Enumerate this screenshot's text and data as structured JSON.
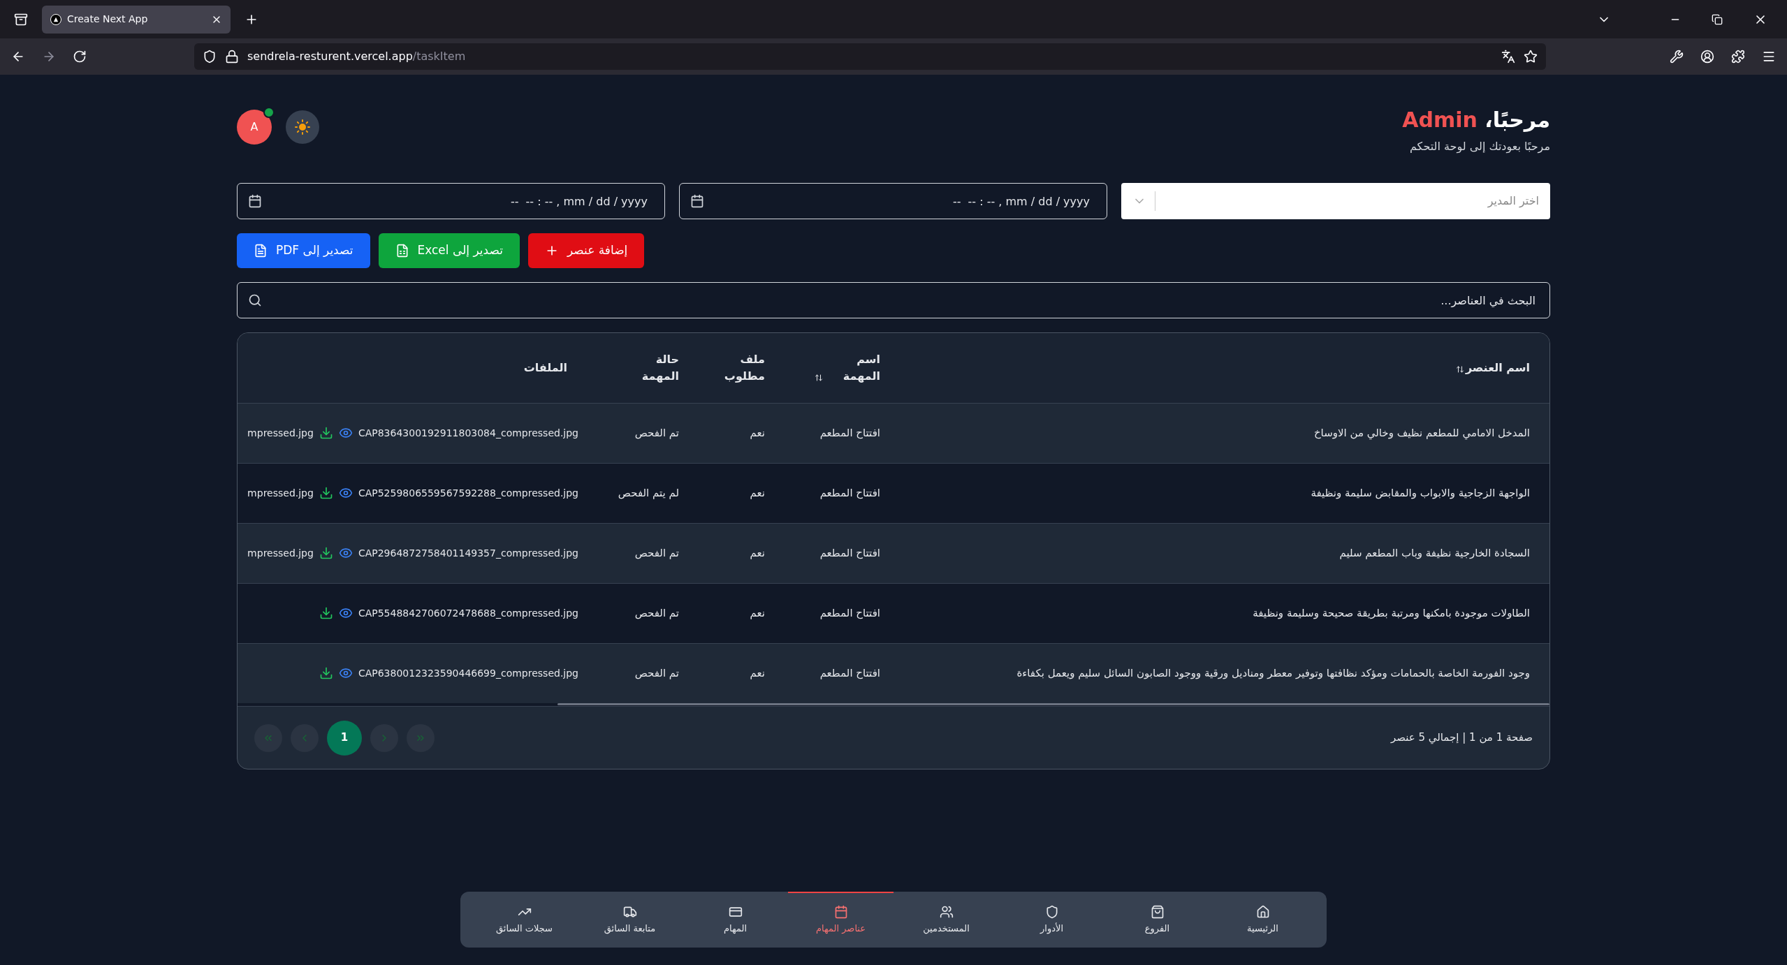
{
  "browser": {
    "tabs": [
      {
        "title": "Create Next App",
        "selected": true
      }
    ],
    "url": {
      "host": "sendrela-resturent.vercel.app",
      "path": "/taskItem"
    }
  },
  "header": {
    "greeting": "مرحبًا،",
    "user": "Admin",
    "subtitle": "مرحبًا بعودتك إلى لوحة التحكم",
    "avatar": "A",
    "online": true
  },
  "filters": {
    "manager": {
      "placeholder": "اختر المدير"
    },
    "dates": [
      {
        "placeholder": "--  -- : -- , mm / dd / yyyy"
      },
      {
        "placeholder": "--  -- : -- , mm / dd / yyyy"
      }
    ]
  },
  "actions": [
    {
      "kind": "add",
      "label": "إضافة عنصر"
    },
    {
      "kind": "excel",
      "label": "تصدير إلى Excel"
    },
    {
      "kind": "pdf",
      "label": "تصدير إلى PDF"
    }
  ],
  "search": {
    "placeholder": "البحث في العناصر..."
  },
  "table": {
    "columns": [
      {
        "label": "اسم العنصر",
        "sortable": true
      },
      {
        "label": "اسم المهمة",
        "sortable": true
      },
      {
        "label": "ملف مطلوب",
        "sortable": false
      },
      {
        "label": "حالة المهمة",
        "sortable": false
      },
      {
        "label": "الملفات",
        "sortable": false
      }
    ],
    "rows": [
      {
        "item": "المدخل الامامي للمطعم نظيف وخالي من الاوساخ",
        "task": "افتتاح المطعم",
        "required": "نعم",
        "status": "تم الفحص",
        "files": [
          "CAP8364300192911803084_compressed.jpg",
          "mpressed.jpg"
        ]
      },
      {
        "item": "الواجهة الزجاجية والابواب والمقابض سليمة ونظيفة",
        "task": "افتتاح المطعم",
        "required": "نعم",
        "status": "لم يتم الفحص",
        "files": [
          "CAP5259806559567592288_compressed.jpg",
          "mpressed.jpg"
        ]
      },
      {
        "item": "السجادة الخارجية نظيفة وباب المطعم سليم",
        "task": "افتتاح المطعم",
        "required": "نعم",
        "status": "تم الفحص",
        "files": [
          "CAP2964872758401149357_compressed.jpg",
          "mpressed.jpg"
        ]
      },
      {
        "item": "الطاولات موجودة بامكنها ومرتبة بطريقة صحيحة وسليمة ونظيفة",
        "task": "افتتاح المطعم",
        "required": "نعم",
        "status": "تم الفحص",
        "files": [
          "CAP5548842706072478688_compressed.jpg"
        ]
      },
      {
        "item": "وجود الفورمة الخاصة بالحمامات ومؤكد نظافتها وتوفير معطر ومناديل ورقية ووجود الصابون السائل سليم ويعمل بكفاءة",
        "task": "افتتاح المطعم",
        "required": "نعم",
        "status": "تم الفحص",
        "files": [
          "CAP6380012323590446699_compressed.jpg"
        ]
      }
    ]
  },
  "pagination": {
    "summary": "صفحة 1 من 1 | إجمالي 5 عنصر",
    "first_disabled": true,
    "prev_disabled": true,
    "pages": [
      {
        "label": "1",
        "selected": true
      }
    ],
    "next_disabled": true,
    "last_disabled": true
  },
  "nav": [
    {
      "label": "الرئيسية",
      "selected": false
    },
    {
      "label": "الفروع",
      "selected": false
    },
    {
      "label": "الأدوار",
      "selected": false
    },
    {
      "label": "المستخدمين",
      "selected": false
    },
    {
      "label": "عناصر المهام",
      "selected": true
    },
    {
      "label": "المهام",
      "selected": false
    },
    {
      "label": "متابعة السائق",
      "selected": false
    },
    {
      "label": "سجلات السائق",
      "selected": false
    }
  ]
}
